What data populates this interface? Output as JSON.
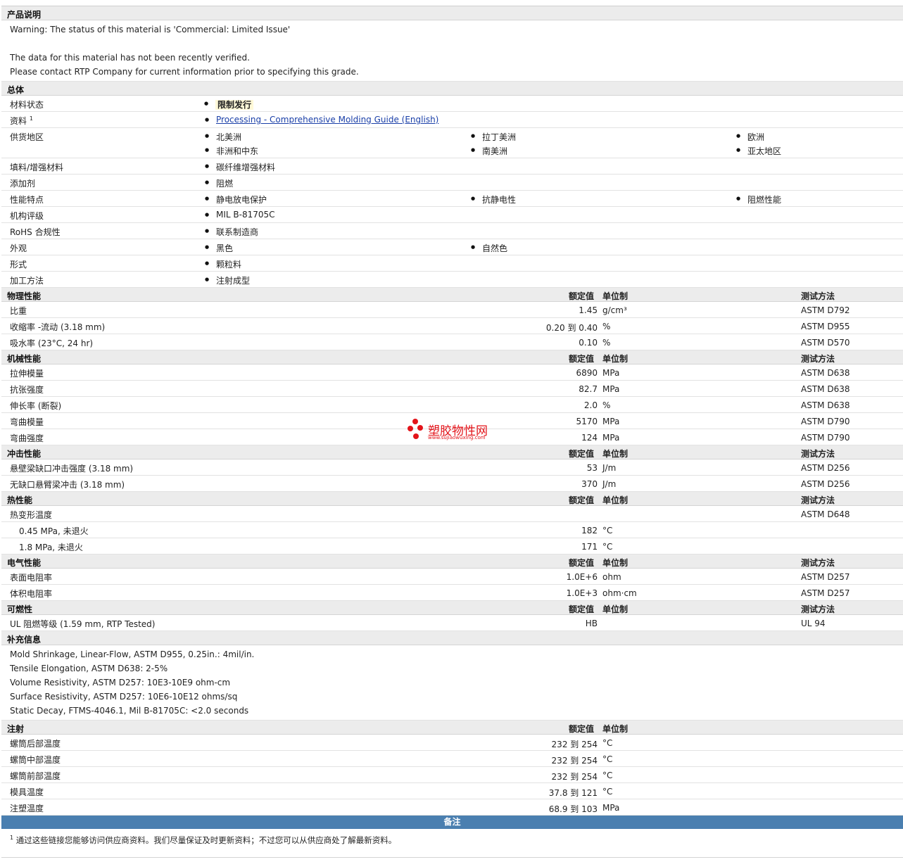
{
  "desc": {
    "title": "产品说明",
    "lines": [
      "Warning: The status of this material is 'Commercial: Limited Issue'",
      "",
      "The data for this material has not been recently verified.",
      "Please contact RTP Company for current information prior to specifying this grade."
    ]
  },
  "general": {
    "title": "总体",
    "rows": [
      {
        "label": "材料状态",
        "items": [
          "限制发行"
        ]
      },
      {
        "label": "资料",
        "sup": "1",
        "items": [
          "Processing - Comprehensive Molding Guide (English)"
        ]
      },
      {
        "label": "供货地区",
        "items": [
          "北美洲",
          "拉丁美洲",
          "欧洲",
          "非洲和中东",
          "南美洲",
          "亚太地区"
        ]
      },
      {
        "label": "填料/增强材料",
        "items": [
          "碳纤维增强材料"
        ]
      },
      {
        "label": "添加剂",
        "items": [
          "阻燃"
        ]
      },
      {
        "label": "性能特点",
        "items": [
          "静电放电保护",
          "抗静电性",
          "阻燃性能"
        ]
      },
      {
        "label": "机构评级",
        "items": [
          "MIL B-81705C"
        ]
      },
      {
        "label": "RoHS 合规性",
        "items": [
          "联系制造商"
        ]
      },
      {
        "label": "外观",
        "items": [
          "黑色",
          "自然色"
        ]
      },
      {
        "label": "形式",
        "items": [
          "颗粒料"
        ]
      },
      {
        "label": "加工方法",
        "items": [
          "注射成型"
        ]
      }
    ]
  },
  "hdr": {
    "value": "额定值",
    "unit": "单位制",
    "method": "测试方法"
  },
  "physical": {
    "title": "物理性能",
    "rows": [
      {
        "label": "比重",
        "value": "1.45",
        "unit": "g/cm³",
        "method": "ASTM D792"
      },
      {
        "label": "收缩率 -流动 (3.18 mm)",
        "value": "0.20 到  0.40",
        "unit": "%",
        "method": "ASTM D955"
      },
      {
        "label": "吸水率 (23°C, 24 hr)",
        "value": "0.10",
        "unit": "%",
        "method": "ASTM D570"
      }
    ]
  },
  "mechanical": {
    "title": "机械性能",
    "rows": [
      {
        "label": "拉伸模量",
        "value": "6890",
        "unit": "MPa",
        "method": "ASTM D638"
      },
      {
        "label": "抗张强度",
        "value": "82.7",
        "unit": "MPa",
        "method": "ASTM D638"
      },
      {
        "label": "伸长率 (断裂)",
        "value": "2.0",
        "unit": "%",
        "method": "ASTM D638"
      },
      {
        "label": "弯曲模量",
        "value": "5170",
        "unit": "MPa",
        "method": "ASTM D790"
      },
      {
        "label": "弯曲强度",
        "value": "124",
        "unit": "MPa",
        "method": "ASTM D790"
      }
    ]
  },
  "impact": {
    "title": "冲击性能",
    "rows": [
      {
        "label": "悬壁梁缺口冲击强度 (3.18 mm)",
        "value": "53",
        "unit": "J/m",
        "method": "ASTM D256"
      },
      {
        "label": "无缺口悬臂梁冲击 (3.18 mm)",
        "value": "370",
        "unit": "J/m",
        "method": "ASTM D256"
      }
    ]
  },
  "thermal": {
    "title": "热性能",
    "rows": [
      {
        "label": "热变形温度",
        "value": "",
        "unit": "",
        "method": "ASTM D648"
      },
      {
        "label": "0.45 MPa, 未退火",
        "value": "182",
        "unit": "°C",
        "method": "",
        "indent": true
      },
      {
        "label": "1.8 MPa, 未退火",
        "value": "171",
        "unit": "°C",
        "method": "",
        "indent": true
      }
    ]
  },
  "electrical": {
    "title": "电气性能",
    "rows": [
      {
        "label": "表面电阻率",
        "value": "1.0E+6",
        "unit": "ohm",
        "method": "ASTM D257"
      },
      {
        "label": "体积电阻率",
        "value": "1.0E+3",
        "unit": "ohm·cm",
        "method": "ASTM D257"
      }
    ]
  },
  "flammability": {
    "title": "可燃性",
    "rows": [
      {
        "label": "UL 阻燃等级 (1.59 mm, RTP Tested)",
        "value": "HB",
        "unit": "",
        "method": "UL 94"
      }
    ]
  },
  "supplement": {
    "title": "补充信息",
    "lines": [
      "Mold Shrinkage, Linear-Flow, ASTM D955, 0.25in.: 4mil/in.",
      "Tensile Elongation, ASTM D638: 2-5%",
      "Volume Resistivity, ASTM D257: 10E3-10E9 ohm-cm",
      "Surface Resistivity, ASTM D257: 10E6-10E12 ohms/sq",
      "Static Decay, FTMS-4046.1, Mil B-81705C: <2.0 seconds"
    ]
  },
  "injection": {
    "title": "注射",
    "rows": [
      {
        "label": "螺筒后部温度",
        "value": "232 到  254",
        "unit": "°C"
      },
      {
        "label": "螺筒中部温度",
        "value": "232 到  254",
        "unit": "°C"
      },
      {
        "label": "螺筒前部温度",
        "value": "232 到  254",
        "unit": "°C"
      },
      {
        "label": "模具温度",
        "value": "37.8 到  121",
        "unit": "°C"
      },
      {
        "label": "注塑温度",
        "value": "68.9 到  103",
        "unit": "MPa"
      }
    ]
  },
  "notes": {
    "title": "备注",
    "sup": "1",
    "text": "通过这些链接您能够访问供应商资料。我们尽量保证及时更新资料；不过您可以从供应商处了解最新资料。"
  },
  "watermark": {
    "name": "塑胶物性网",
    "url": "www.sujiaowuxing.com"
  },
  "colors": {
    "section_bg": "#ececec",
    "notes_bar": "#4a7fb0",
    "link": "#1a3fa8",
    "watermark": "#e3141a"
  }
}
